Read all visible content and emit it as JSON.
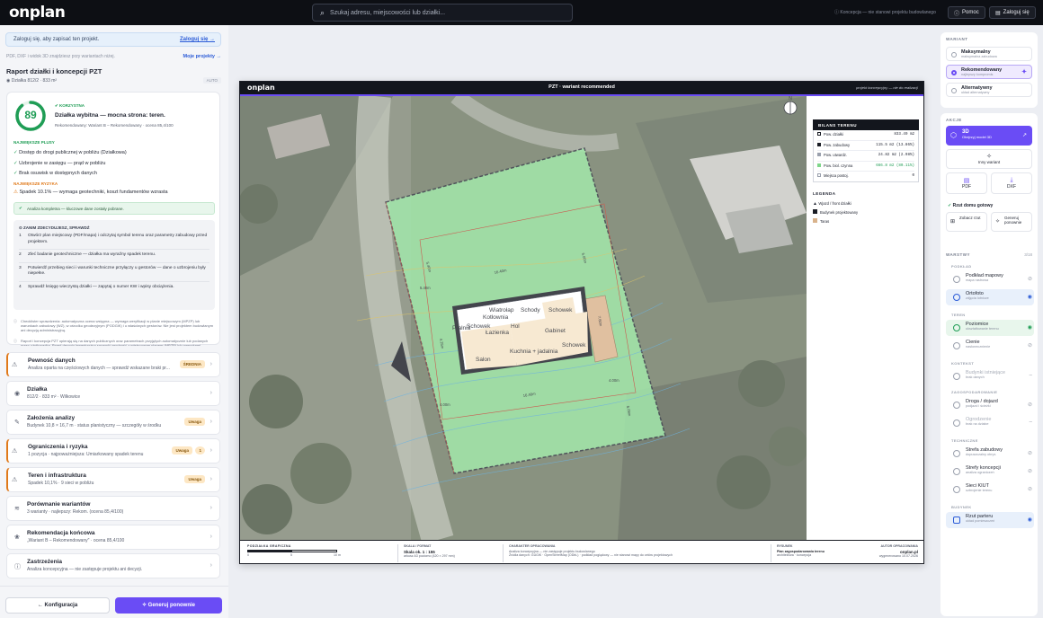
{
  "app": {
    "logo": "onplan"
  },
  "search": {
    "placeholder": "Szukaj adresu, miejscowości lub działki..."
  },
  "topbar": {
    "note": "Koncepcja — nie stanowi projektu budowlanego",
    "help_label": "Pomoc",
    "login_label": "Zaloguj się"
  },
  "left": {
    "login_banner": {
      "text": "Zaloguj się, aby zapisać ten projekt.",
      "link": "Zaloguj się →"
    },
    "export_note": "PDF, DXF i widok 3D znajdziesz przy wariantach niżej.",
    "my_projects": "Moje projekty →",
    "report_title": "Raport działki i koncepcji PZT",
    "report_sub": "Działka 812/2 · 833 m²",
    "auto_badge": "AUTO",
    "score": {
      "value": "89",
      "fraction": 0.89,
      "verdict": "KORZYSTNA",
      "headline": "Działka wybitna — mocna strona: teren.",
      "detail": "Rekomendowany: Wariant B – Rekomendowany · ocena 85,4/100"
    },
    "pros_title": "NAJWIĘKSZE PLUSY",
    "pros": [
      "Dostęp do drogi publicznej w pobliżu (Działkowa)",
      "Uzbrojenie w zasięgu — prąd w pobliżu",
      "Brak osuwisk w dostępnych danych"
    ],
    "risks_title": "NAJWIĘKSZE RYZYKA",
    "risks": [
      "Spadek 10.1% — wymaga geotechniki, koszt fundamentów wzrasta"
    ],
    "analysis_done": "Analiza kompletna — kluczowe dane zostały pobrane.",
    "steps_title": "ZANIM ZDECYDUJESZ, SPRAWDŹ",
    "steps": [
      {
        "n": "1",
        "text": "Otwórz plan miejscowy (PDF/mapa) i odczytaj symbol terenu oraz parametry zabudowy przed projektem."
      },
      {
        "n": "2",
        "text": "Zleć badanie geotechniczne — działka ma wyraźny spadek terenu."
      },
      {
        "n": "3",
        "text": "Potwierdź przebieg sieci i warunki techniczne przyłączy u gestorów — dane o uzbrojeniu były niepełne."
      },
      {
        "n": "4",
        "text": "Sprawdź księgę wieczystą działki — zapytaj o numer KW i wpisy obciążenia."
      }
    ],
    "disclaimer1": "Checklister sprawdzenia: automatyczna ocena wstępna — wymaga weryfikacji w planie miejscowym (MPZP) lub warunkach zabudowy (WZ), w ośrodku geodezyjnym (PODGiK) i u właściwych gestorów. Nie jest projektem budowlanym ani decyzją administracyjną.",
    "disclaimer2": "Raport i koncepcja PZT opierają się na danych publicznych oraz parametrach przyjętych automatycznie lub podanych przez użytkownika. Przed decyzją inwestycyjną sprawdź zgodność z miejscowym planem (MPZP) lub warunkami zabudowy (WZ).",
    "rows": [
      {
        "title": "Pewność danych",
        "sub": "Analiza oparta na częściowych danych — sprawdź wskazane braki pr...",
        "badge": "ŚREDNIA"
      },
      {
        "title": "Działka",
        "sub": "812/2 · 833 m² · Wilkowice",
        "badge": ""
      },
      {
        "title": "Założenia analizy",
        "sub": "Budynek 10,8 × 16,7 m · status planistyczny — szczegóły w środku",
        "badge": "Uwaga"
      },
      {
        "title": "Ograniczenia i ryzyka",
        "sub": "1 pozycja · najpoważniejsza: Umiarkowany spadek terenu",
        "badge": "Uwaga",
        "count": "1"
      },
      {
        "title": "Teren i infrastruktura",
        "sub": "Spadek 10,1% · 9 sieci w pobliżu",
        "badge": "Uwaga"
      },
      {
        "title": "Porównanie wariantów",
        "sub": "3 warianty · najlepszy: Rekom. (ocena 85,4/100)",
        "badge": ""
      },
      {
        "title": "Rekomendacja końcowa",
        "sub": "„Wariant B – Rekomendowany\" · ocena 85,4/100",
        "badge": ""
      },
      {
        "title": "Zastrzeżenia",
        "sub": "Analiza koncepcyjna — nie zastępuje projektu ani decyzji.",
        "badge": ""
      }
    ],
    "config_label": "Konfiguracja",
    "generate_label": "Generuj ponownie"
  },
  "sheet": {
    "logo": "onplan",
    "title": "PZT · wariant recommended",
    "tagline": "projekt koncepcyjny — nie do realizacji",
    "north": "N",
    "balance_title": "BILANS TERENU",
    "balance": [
      {
        "label": "Pow. działki",
        "value": "833.49 m2"
      },
      {
        "label": "Pow. zabudowy",
        "value": "115.5 m2 (13.86%)"
      },
      {
        "label": "Pow. utwardz.",
        "value": "24.82 m2 (2.98%)"
      },
      {
        "label": "Pow. biol. czynna",
        "value": "666.8 m2 (80.11%)"
      },
      {
        "label": "Miejsca postoj.",
        "value": "0"
      }
    ],
    "legend_title": "LEGENDA",
    "legend": [
      "Wjazd / front działki",
      "Budynek projektowany",
      "Taras"
    ],
    "dims": [
      "16.40m",
      "16.40m",
      "5.40m",
      "4.00m",
      "4.00m",
      "6.09m",
      "5.40m",
      "4.25m",
      "7.60m",
      "6.00m"
    ],
    "rooms": [
      "Wiatrołap",
      "Kotłownia",
      "Schowek",
      "Schody",
      "Schowek",
      "Pralnia",
      "Hol",
      "Łazienka",
      "Gabinet",
      "Salon",
      "Kuchnia + jadalnia",
      "Schowek"
    ],
    "footer": {
      "scale_bar_title": "PODZIAŁKA GRAFICZNA",
      "scale_ticks": [
        "0",
        "5",
        "10 m"
      ],
      "scale_title": "SKALA / FORMAT",
      "scale_value": "Skala ok. 1 : 155",
      "scale_sub": "arkusz A3 poziomo (420 × 297 mm)",
      "author_title": "CHARAKTER OPRACOWANIA",
      "author_l1": "Analiza koncepcyjna — nie zastępuje projektu budowlanego",
      "author_l2": "Źródła danych: GUGiK · OpenStreetMap (ODbL) · podkład poglądowy — nie stanowi mapy do celów projektowych",
      "sheet_title": "RYSUNEK",
      "sheet_value": "Plan zagospodarowania terenu",
      "sheet_sub": "architektura · koncepcja",
      "brand_title": "AUTOR OPRACOWANIA",
      "brand_value": "onplan.pl",
      "brand_sub": "wygenerowano 10.07.2026"
    }
  },
  "right": {
    "variants_title": "WARIANT",
    "variants": [
      {
        "name": "Maksymalny",
        "sub": "maksymalna zabudowa"
      },
      {
        "name": "Rekomendowany",
        "sub": "najlepszy kompromis"
      },
      {
        "name": "Alternatywny",
        "sub": "układ alternatywny"
      }
    ],
    "actions_title": "AKCJE",
    "btn_3d": "3D",
    "btn_3d_sub": "Obejrzyj model 3D",
    "other_variant": "Inny wariant",
    "pdf": "PDF",
    "dxf": "DXF",
    "floor_ready": "Rzut domu gotowy",
    "show_floor": "Zobacz rzut",
    "regen_floor": "Generuj ponownie",
    "layers_title": "WARSTWY",
    "layers_count": "3/18",
    "groups": [
      {
        "name": "PODKŁAD",
        "items": [
          {
            "name": "Podkład mapowy",
            "sub": "mapa rastrowa"
          },
          {
            "name": "Ortofoto",
            "sub": "zdjęcia lotnicze"
          }
        ]
      },
      {
        "name": "TEREN",
        "items": [
          {
            "name": "Poziomice",
            "sub": "ukształtowanie terenu"
          },
          {
            "name": "Cienie",
            "sub": "nasłonecznienie"
          }
        ]
      },
      {
        "name": "KONTEKST",
        "items": [
          {
            "name": "Budynki istniejące",
            "sub": "brak danych"
          }
        ]
      },
      {
        "name": "ZAGOSPODAROWANIE",
        "items": [
          {
            "name": "Droga / dojazd",
            "sub": "podjazd i ścieżki"
          },
          {
            "name": "Ogrodzenie",
            "sub": "brak na działce"
          }
        ]
      },
      {
        "name": "TECHNICZNE",
        "items": [
          {
            "name": "Strefa zabudowy",
            "sub": "dopuszczalny obrys"
          },
          {
            "name": "Strefy koncepcji",
            "sub": "analiza ograniczeń"
          },
          {
            "name": "Sieci KIUT",
            "sub": "uzbrojenie terenu"
          }
        ]
      },
      {
        "name": "BUDYNEK",
        "items": [
          {
            "name": "Rzut parteru",
            "sub": "układ pomieszczeń"
          }
        ]
      }
    ]
  },
  "colors": {
    "accent": "#6a4cf5",
    "green": "#1f9d55",
    "orange": "#e0791a",
    "plot": "#7fd68a"
  }
}
